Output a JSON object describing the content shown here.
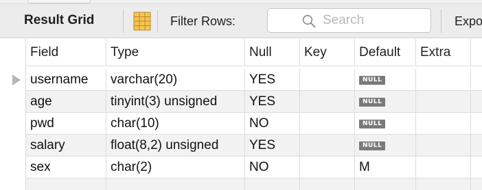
{
  "toolbar": {
    "title": "Result Grid",
    "filter_label": "Filter Rows:",
    "search_placeholder": "Search",
    "export_label": "Expo"
  },
  "grid": {
    "columns": [
      "Field",
      "Type",
      "Null",
      "Key",
      "Default",
      "Extra"
    ],
    "rows": [
      {
        "field": "username",
        "type": "varchar(20)",
        "null": "YES",
        "key": "",
        "default": "NULL",
        "extra": ""
      },
      {
        "field": "age",
        "type": "tinyint(3) unsigned",
        "null": "YES",
        "key": "",
        "default": "NULL",
        "extra": ""
      },
      {
        "field": "pwd",
        "type": "char(10)",
        "null": "NO",
        "key": "",
        "default": "NULL",
        "extra": ""
      },
      {
        "field": "salary",
        "type": "float(8,2) unsigned",
        "null": "YES",
        "key": "",
        "default": "NULL",
        "extra": ""
      },
      {
        "field": "sex",
        "type": "char(2)",
        "null": "NO",
        "key": "",
        "default": "M",
        "extra": ""
      }
    ]
  },
  "icons": {
    "result_grid_icon": "grid-icon",
    "search_icon": "search-icon",
    "row_marker": "current-row-arrow-icon"
  },
  "colors": {
    "null_badge": "#7a7a7a",
    "alt_row": "#f2f2f2",
    "grid_icon": "#f2b52e"
  }
}
